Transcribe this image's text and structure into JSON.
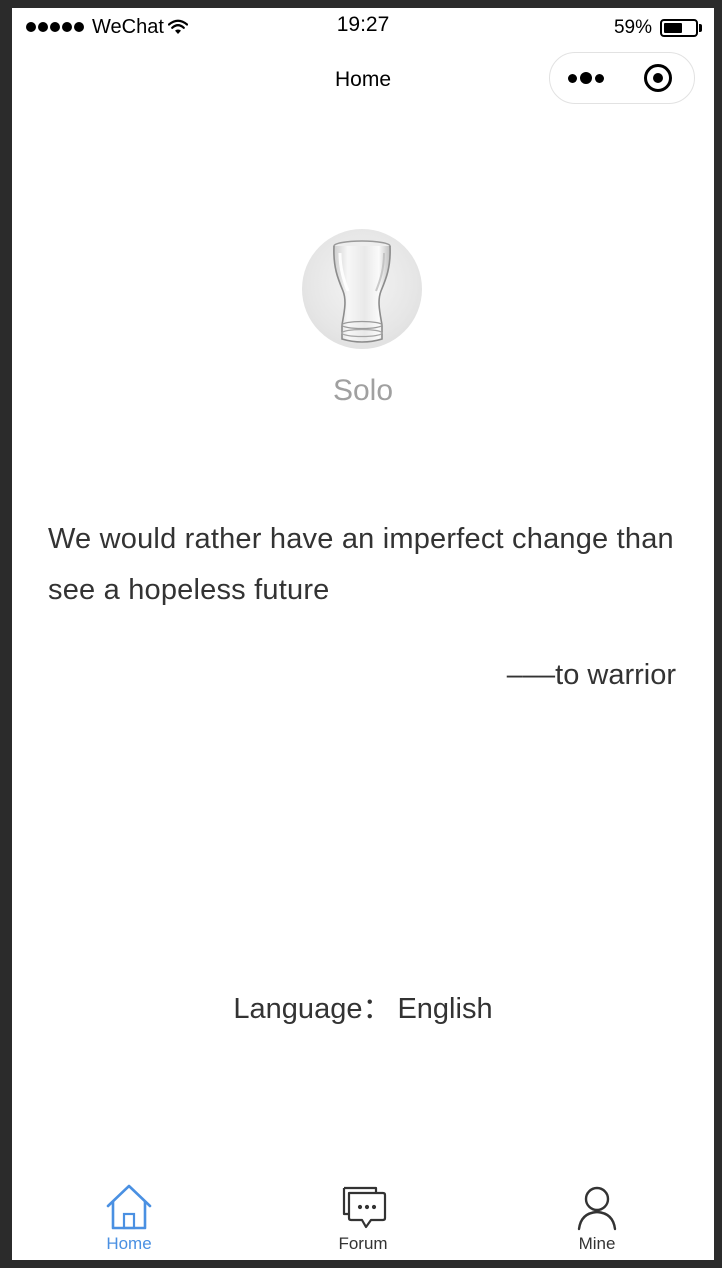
{
  "status_bar": {
    "carrier": "WeChat",
    "time": "19:27",
    "battery_percent_text": "59%",
    "battery_level": 0.59
  },
  "nav_bar": {
    "title": "Home"
  },
  "profile": {
    "username": "Solo",
    "avatar_icon": "glass-avatar"
  },
  "quote": {
    "text": "We would rather have an imperfect change than see a hopeless future",
    "author": "–––to warrior"
  },
  "language": {
    "label": "Language：",
    "value": "English"
  },
  "tab_bar": {
    "active_color": "#4a90e2",
    "inactive_color": "#333333",
    "tabs": [
      {
        "label": "Home",
        "icon": "home-icon",
        "active": true
      },
      {
        "label": "Forum",
        "icon": "chat-icon",
        "active": false
      },
      {
        "label": "Mine",
        "icon": "user-icon",
        "active": false
      }
    ]
  }
}
